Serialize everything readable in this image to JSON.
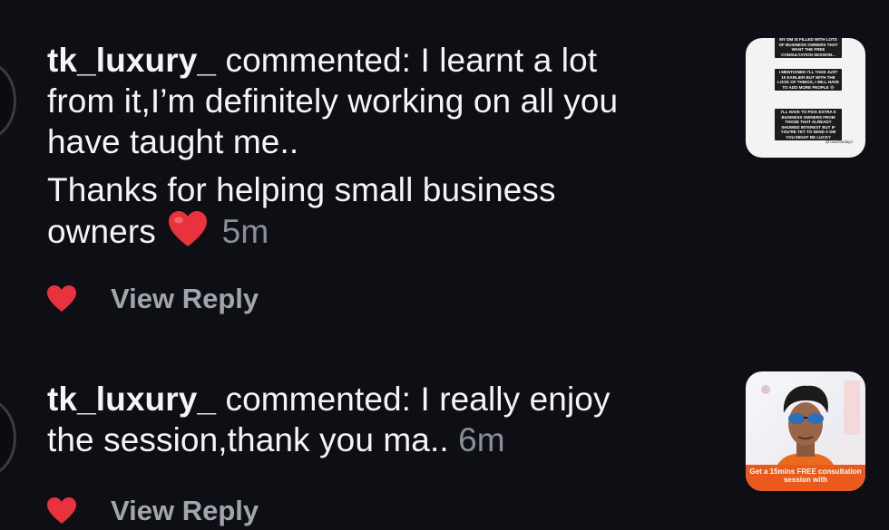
{
  "comments": [
    {
      "username": "tk_luxury_",
      "text_line1_rest": " commented: I learnt a lot",
      "text_line2": "from it,I’m definitely working on all you",
      "text_line3": "have taught me..",
      "text_line4": "Thanks for helping small business",
      "text_line5": "owners",
      "emoji": "heart-emoji",
      "time": "5m",
      "view_reply_label": "View Reply",
      "liked": true
    },
    {
      "username": "tk_luxury_",
      "text_line1_rest": " commented: I really enjoy",
      "text_line2": "the session,thank you ma..",
      "time": "6m",
      "view_reply_label": "View Reply",
      "liked": true
    }
  ],
  "thumbnails": {
    "first": {
      "box1": "MY DM IS FILLED WITH LOTS OF BUSINESS OWNERS THAT WANT THE FREE CONSULTATION SESSION...",
      "box2": "I MENTIONED I'LL TAKE JUST 10 EARLIER BUT WITH THE LOOK OF THINGS, I WILL HAVE TO ADD MORE PEOPLE 😅",
      "box3": "I'LL HAVE TO PICK EXTRA 5 BUSINESS OWNERS FROM THOSE THAT ALREADY SHOWED INTEREST BUT IF YOU'RE YET TO SEND A DM YOU MIGHT BE LUCKY",
      "handle": "@coachfedayo"
    },
    "second": {
      "banner": "Get a 15mins FREE consultation session with"
    }
  },
  "colors": {
    "background": "#0e0f14",
    "like_red": "#e8333f",
    "secondary_text": "#8d8f98"
  }
}
